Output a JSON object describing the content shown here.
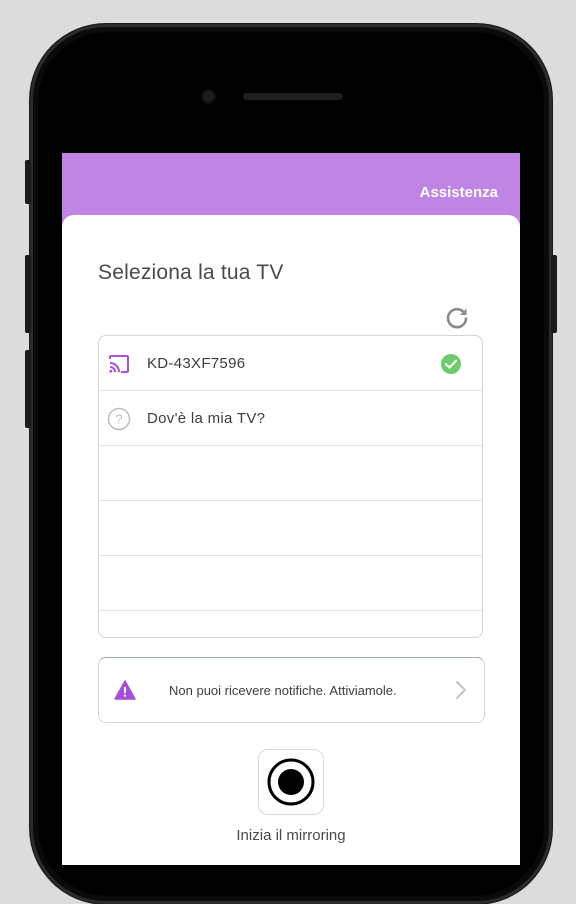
{
  "header": {
    "help_link": "Assistenza"
  },
  "page": {
    "title": "Seleziona la tua TV"
  },
  "devices": {
    "items": [
      {
        "label": "KD-43XF7596",
        "icon": "cast-icon",
        "status": "connected-check-icon"
      },
      {
        "label": "Dov'è la mia TV?",
        "icon": "help-circle-icon"
      }
    ]
  },
  "notification_banner": {
    "text": "Non puoi ricevere notifiche. Attiviamole.",
    "icon": "warning-icon"
  },
  "mirroring": {
    "label": "Inizia il mirroring",
    "icon": "record-icon"
  },
  "colors": {
    "accent": "#c084e4",
    "cast_icon": "#b04ee0",
    "check_green": "#6ccc6a",
    "warning": "#a64fd6"
  }
}
